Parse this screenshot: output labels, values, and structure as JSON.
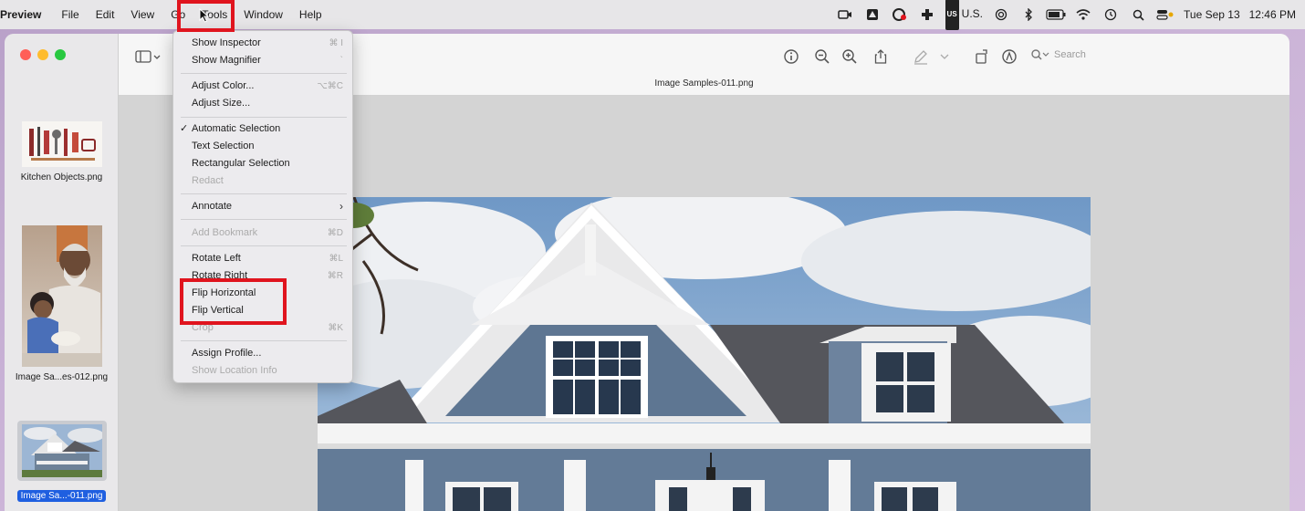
{
  "menubar": {
    "app_name": "Preview",
    "items": [
      "File",
      "Edit",
      "View",
      "Go",
      "Tools",
      "Window",
      "Help"
    ],
    "status": {
      "input_source_badge": "US",
      "input_source_label": "U.S.",
      "date": "Tue Sep 13",
      "time": "12:46 PM"
    }
  },
  "sidebar": {
    "thumbnails": [
      {
        "label": "Kitchen Objects.png",
        "selected": false
      },
      {
        "label": "Image Sa...es-012.png",
        "selected": false
      },
      {
        "label": "Image Sa...-011.png",
        "selected": true
      }
    ]
  },
  "toolbar": {
    "document_title": "Image Samples-011.png",
    "search_placeholder": "Search"
  },
  "tools_menu": {
    "items": [
      {
        "label": "Show Inspector",
        "shortcut": "⌘ I",
        "enabled": true
      },
      {
        "label": "Show Magnifier",
        "shortcut": "`",
        "enabled": true
      },
      {
        "label": "Adjust Color...",
        "shortcut": "⌥⌘C",
        "enabled": true
      },
      {
        "label": "Adjust Size...",
        "shortcut": "",
        "enabled": true
      },
      {
        "label": "Automatic Selection",
        "shortcut": "",
        "enabled": true,
        "checked": true
      },
      {
        "label": "Text Selection",
        "shortcut": "",
        "enabled": true
      },
      {
        "label": "Rectangular Selection",
        "shortcut": "",
        "enabled": true
      },
      {
        "label": "Redact",
        "shortcut": "",
        "enabled": false
      },
      {
        "label": "Annotate",
        "shortcut": "",
        "enabled": true,
        "submenu": true
      },
      {
        "label": "Add Bookmark",
        "shortcut": "⌘D",
        "enabled": false
      },
      {
        "label": "Rotate Left",
        "shortcut": "⌘L",
        "enabled": true
      },
      {
        "label": "Rotate Right",
        "shortcut": "⌘R",
        "enabled": true
      },
      {
        "label": "Flip Horizontal",
        "shortcut": "",
        "enabled": true
      },
      {
        "label": "Flip Vertical",
        "shortcut": "",
        "enabled": true
      },
      {
        "label": "Crop",
        "shortcut": "⌘K",
        "enabled": false
      },
      {
        "label": "Assign Profile...",
        "shortcut": "",
        "enabled": true
      },
      {
        "label": "Show Location Info",
        "shortcut": "",
        "enabled": false
      }
    ]
  },
  "colors": {
    "highlight_red": "#e0141e",
    "selection_blue": "#1f5fe0",
    "menubar_bg": "#e7e6e8"
  }
}
